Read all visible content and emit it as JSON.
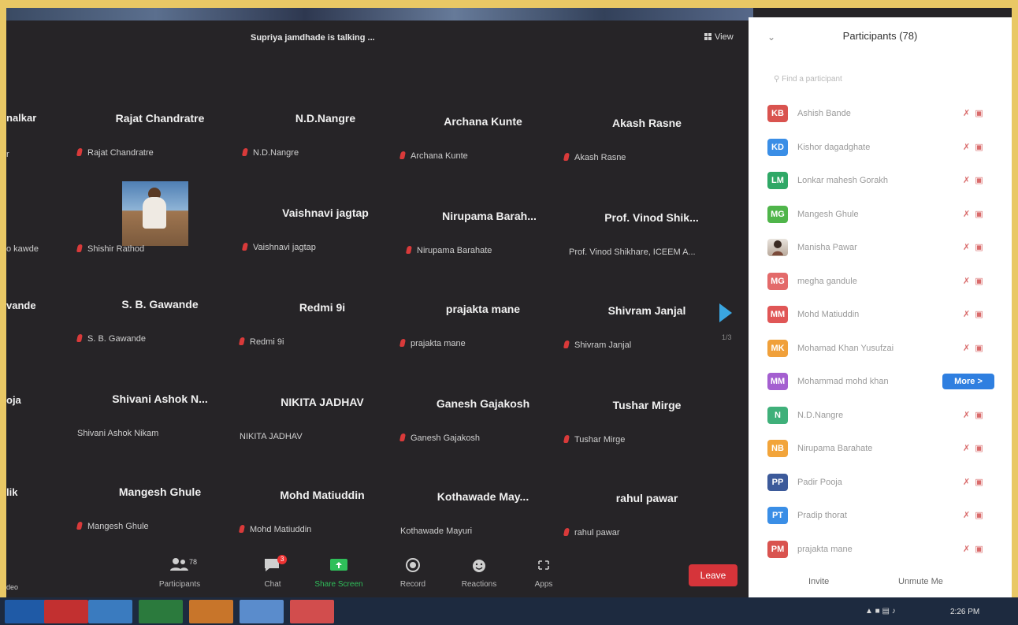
{
  "meeting": {
    "talking_indicator": "Supriya jamdhade is talking ...",
    "view_label": "View",
    "page_indicator": "1/3"
  },
  "left_cut_names": {
    "r1": "nalkar",
    "r1sub": "r",
    "r2sub": "o kawde",
    "r3": "vande",
    "r4": "oja",
    "r5": "lik",
    "r6sub": "deo"
  },
  "tiles": [
    {
      "name": "Rajat Chandratre",
      "sub": "Rajat Chandratre",
      "muted": true
    },
    {
      "name": "N.D.Nangre",
      "sub": "N.D.Nangre",
      "muted": true
    },
    {
      "name": "Archana Kunte",
      "sub": "Archana Kunte",
      "muted": true
    },
    {
      "name": "Akash Rasne",
      "sub": "Akash Rasne",
      "muted": true
    },
    {
      "name": "",
      "sub": "Shishir Rathod",
      "muted": true,
      "photo": true
    },
    {
      "name": "Vaishnavi jagtap",
      "sub": "Vaishnavi jagtap",
      "muted": true
    },
    {
      "name": "Nirupama  Barah...",
      "sub": "Nirupama Barahate",
      "muted": true
    },
    {
      "name": "Prof. Vinod  Shik...",
      "sub": "Prof. Vinod Shikhare, ICEEM A...",
      "muted": false
    },
    {
      "name": "S. B. Gawande",
      "sub": "S. B. Gawande",
      "muted": true
    },
    {
      "name": "Redmi 9i",
      "sub": "Redmi 9i",
      "muted": true
    },
    {
      "name": "prajakta mane",
      "sub": "prajakta mane",
      "muted": true
    },
    {
      "name": "Shivram Janjal",
      "sub": "Shivram Janjal",
      "muted": true
    },
    {
      "name": "Shivani Ashok N...",
      "sub": "Shivani Ashok Nikam",
      "muted": false
    },
    {
      "name": "NIKITA JADHAV",
      "sub": "NIKITA JADHAV",
      "muted": false
    },
    {
      "name": "Ganesh Gajakosh",
      "sub": "Ganesh Gajakosh",
      "muted": true
    },
    {
      "name": "Tushar Mirge",
      "sub": "Tushar Mirge",
      "muted": true
    },
    {
      "name": "Mangesh Ghule",
      "sub": "Mangesh Ghule",
      "muted": true
    },
    {
      "name": "Mohd Matiuddin",
      "sub": "Mohd Matiuddin",
      "muted": true
    },
    {
      "name": "Kothawade  May...",
      "sub": "Kothawade Mayuri",
      "muted": false
    },
    {
      "name": "rahul pawar",
      "sub": "rahul pawar",
      "muted": true
    }
  ],
  "toolbar": {
    "participants_label": "Participants",
    "participants_count": "78",
    "chat_label": "Chat",
    "chat_badge": "3",
    "share_label": "Share Screen",
    "record_label": "Record",
    "reactions_label": "Reactions",
    "apps_label": "Apps",
    "leave_label": "Leave"
  },
  "panel": {
    "title": "Participants (78)",
    "search_placeholder": "Find a participant",
    "rows": [
      {
        "initials": "KB",
        "color": "#d9534f",
        "name": "Ashish Bande",
        "show_more": false
      },
      {
        "initials": "KD",
        "color": "#3a8ee6",
        "name": "Kishor dagadghate",
        "show_more": false
      },
      {
        "initials": "LM",
        "color": "#2fa866",
        "name": "Lonkar mahesh Gorakh",
        "show_more": false
      },
      {
        "initials": "MG",
        "color": "#4fb54a",
        "name": "Mangesh Ghule",
        "show_more": false
      },
      {
        "initials": "",
        "color": "#ffffff",
        "name": "Manisha Pawar",
        "show_more": false,
        "photo": true
      },
      {
        "initials": "MG",
        "color": "#e36a6a",
        "name": "megha gandule",
        "show_more": false
      },
      {
        "initials": "MM",
        "color": "#e05656",
        "name": "Mohd Matiuddin",
        "show_more": false
      },
      {
        "initials": "MK",
        "color": "#f0a03a",
        "name": "Mohamad Khan Yusufzai",
        "show_more": false
      },
      {
        "initials": "MM",
        "color": "#a45fd0",
        "name": "Mohammad mohd khan",
        "show_more": true
      },
      {
        "initials": "N",
        "color": "#3fb07a",
        "name": "N.D.Nangre",
        "show_more": false
      },
      {
        "initials": "NB",
        "color": "#f2a43a",
        "name": "Nirupama Barahate",
        "show_more": false
      },
      {
        "initials": "PP",
        "color": "#3c5a9a",
        "name": "Padir Pooja",
        "show_more": false
      },
      {
        "initials": "PT",
        "color": "#3a8ee6",
        "name": "Pradip thorat",
        "show_more": false
      },
      {
        "initials": "PM",
        "color": "#d9534f",
        "name": "prajakta mane",
        "show_more": false
      }
    ],
    "more_label": "More >",
    "invite_label": "Invite",
    "unmute_label": "Unmute Me"
  },
  "taskbar": {
    "clock": "2:26 PM"
  }
}
